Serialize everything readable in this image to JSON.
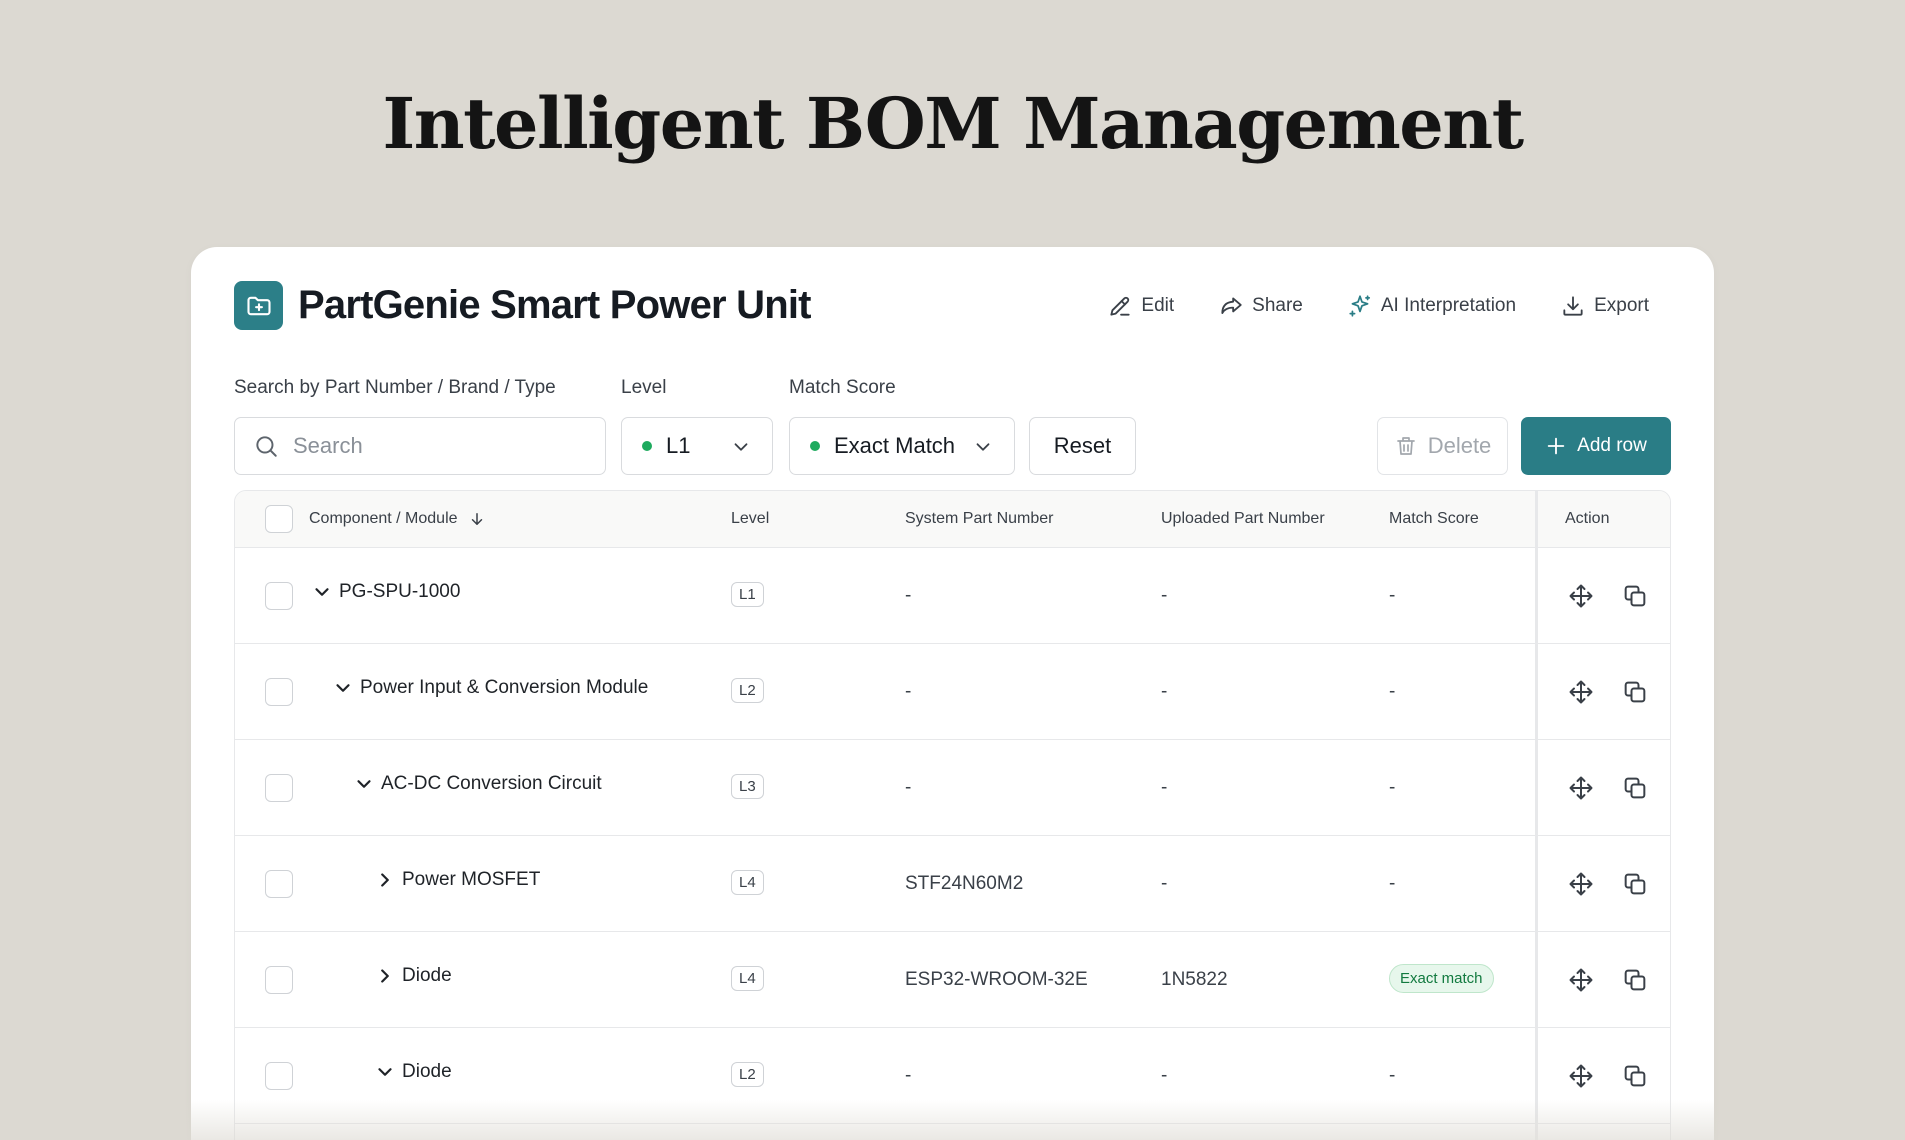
{
  "hero": {
    "title": "Intelligent BOM Management"
  },
  "header": {
    "title": "PartGenie Smart Power Unit",
    "actions": {
      "edit": "Edit",
      "share": "Share",
      "ai": "AI Interpretation",
      "export": "Export"
    }
  },
  "filters": {
    "search_label": "Search by Part Number / Brand / Type",
    "search_placeholder": "Search",
    "level_label": "Level",
    "level_value": "L1",
    "match_label": "Match Score",
    "match_value": "Exact Match",
    "reset": "Reset",
    "delete": "Delete",
    "add_row": "Add row"
  },
  "table": {
    "columns": {
      "component": "Component / Module",
      "level": "Level",
      "system": "System Part Number",
      "uploaded": "Uploaded Part Number",
      "match": "Match Score",
      "action": "Action"
    },
    "rows": [
      {
        "name": "PG-SPU-1000",
        "level": "L1",
        "system": "-",
        "uploaded": "-",
        "match": "-",
        "expanded": true,
        "depth": 0
      },
      {
        "name": "Power Input & Conversion Module",
        "level": "L2",
        "system": "-",
        "uploaded": "-",
        "match": "-",
        "expanded": true,
        "depth": 1
      },
      {
        "name": "AC-DC Conversion Circuit",
        "level": "L3",
        "system": "-",
        "uploaded": "-",
        "match": "-",
        "expanded": true,
        "depth": 2
      },
      {
        "name": "Power MOSFET",
        "level": "L4",
        "system": "STF24N60M2",
        "uploaded": "-",
        "match": "-",
        "expanded": false,
        "depth": 3
      },
      {
        "name": "Diode",
        "level": "L4",
        "system": "ESP32-WROOM-32E",
        "uploaded": "1N5822",
        "match": "Exact match",
        "expanded": false,
        "depth": 3
      },
      {
        "name": "Diode",
        "level": "L2",
        "system": "-",
        "uploaded": "-",
        "match": "-",
        "expanded": true,
        "depth": 3
      }
    ]
  },
  "colors": {
    "accent": "#2a7d86",
    "match_green": "#1eaa5e"
  },
  "icons": {
    "folder": "folder-plus-icon",
    "edit": "pencil-icon",
    "share": "share-arrow-icon",
    "ai": "sparkle-icon",
    "export": "download-icon",
    "search": "search-icon",
    "chevron": "chevron-down-icon",
    "trash": "trash-icon",
    "plus": "plus-icon",
    "move": "move-arrows-icon",
    "copy": "copy-icon",
    "sort": "arrow-down-icon"
  }
}
